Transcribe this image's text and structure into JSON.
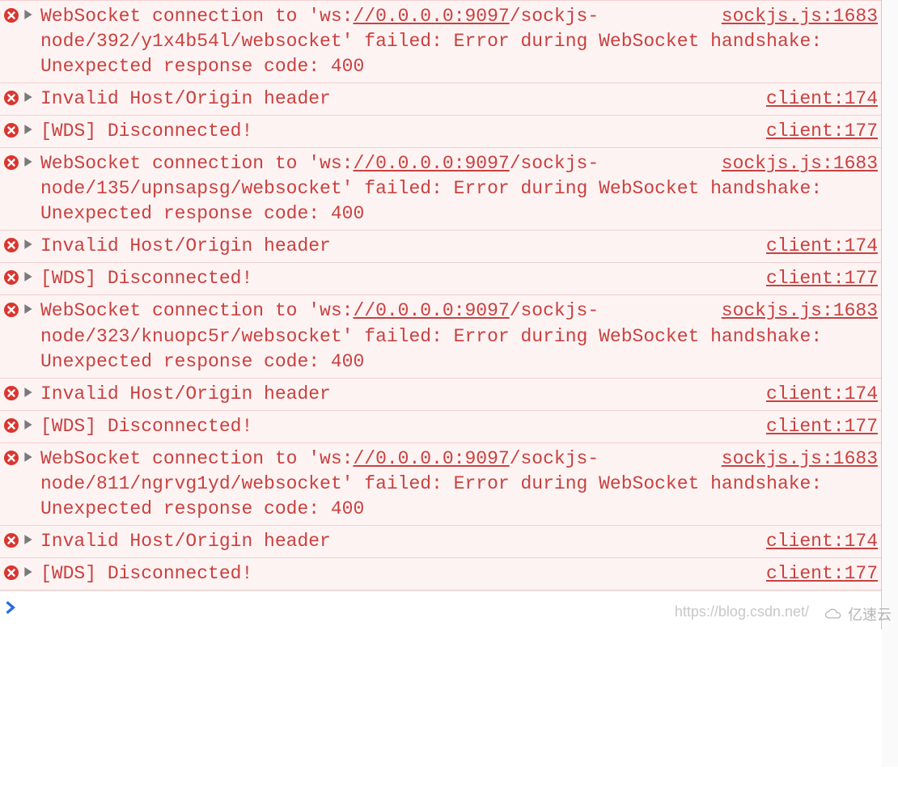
{
  "errors": [
    {
      "type": "ws",
      "pre": "WebSocket connection to 'ws:",
      "url": "//0.0.0.0:9097",
      "post": "/sockjs-node/392/y1x4b54l/websocket' failed: Error during WebSocket handshake: Unexpected response code: 400",
      "source": "sockjs.js:1683"
    },
    {
      "type": "plain",
      "text": "Invalid Host/Origin header",
      "source": "client:174"
    },
    {
      "type": "plain",
      "text": "[WDS] Disconnected!",
      "source": "client:177"
    },
    {
      "type": "ws",
      "pre": "WebSocket connection to 'ws:",
      "url": "//0.0.0.0:9097",
      "post": "/sockjs-node/135/upnsapsg/websocket' failed: Error during WebSocket handshake: Unexpected response code: 400",
      "source": "sockjs.js:1683"
    },
    {
      "type": "plain",
      "text": "Invalid Host/Origin header",
      "source": "client:174"
    },
    {
      "type": "plain",
      "text": "[WDS] Disconnected!",
      "source": "client:177"
    },
    {
      "type": "ws",
      "pre": "WebSocket connection to 'ws:",
      "url": "//0.0.0.0:9097",
      "post": "/sockjs-node/323/knuopc5r/websocket' failed: Error during WebSocket handshake: Unexpected response code: 400",
      "source": "sockjs.js:1683"
    },
    {
      "type": "plain",
      "text": "Invalid Host/Origin header",
      "source": "client:174"
    },
    {
      "type": "plain",
      "text": "[WDS] Disconnected!",
      "source": "client:177"
    },
    {
      "type": "ws",
      "pre": "WebSocket connection to 'ws:",
      "url": "//0.0.0.0:9097",
      "post": "/sockjs-node/811/ngrvg1yd/websocket' failed: Error during WebSocket handshake: Unexpected response code: 400",
      "source": "sockjs.js:1683"
    },
    {
      "type": "plain",
      "text": "Invalid Host/Origin header",
      "source": "client:174"
    },
    {
      "type": "plain",
      "text": "[WDS] Disconnected!",
      "source": "client:177"
    }
  ],
  "footer_url": "https://blog.csdn.net/",
  "watermark_text": "亿速云"
}
